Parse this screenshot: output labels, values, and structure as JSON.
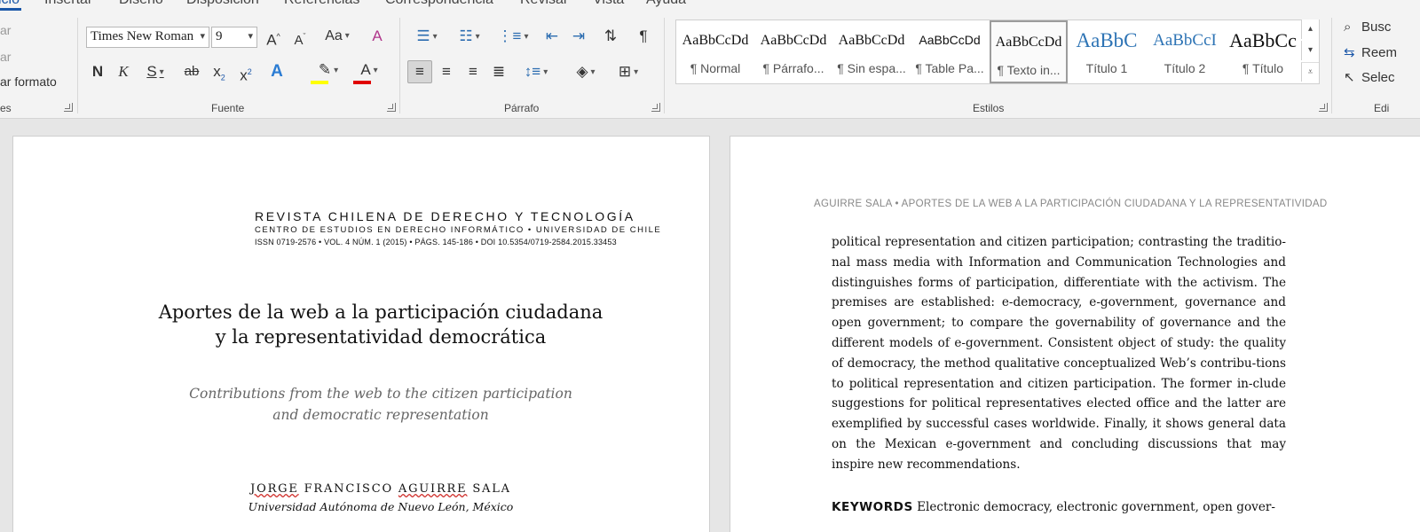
{
  "ribbon_tabs": [
    "icio",
    "Insertar",
    "Diseño",
    "Disposición",
    "Referencias",
    "Correspondencia",
    "Revisar",
    "Vista",
    "Ayuda"
  ],
  "clipboard": {
    "items": [
      "ar",
      "ar",
      "ar formato"
    ],
    "label": "es"
  },
  "font": {
    "name": "Times New Roman",
    "size": "9",
    "label": "Fuente",
    "grow": "A",
    "shrink": "A",
    "case": "Aa",
    "bold": "N",
    "italic": "K",
    "underline": "S",
    "strike": "ab",
    "subscript": "x",
    "superscript": "x",
    "effects": "A",
    "font_color": "A",
    "highlight_color": "#ffff00",
    "text_color": "#e00000"
  },
  "paragraph": {
    "label": "Párrafo"
  },
  "styles": {
    "label": "Estilos",
    "items": [
      {
        "sample": "AaBbCcDd",
        "name": "¶ Normal"
      },
      {
        "sample": "AaBbCcDd",
        "name": "¶ Párrafo..."
      },
      {
        "sample": "AaBbCcDd",
        "name": "¶ Sin espa..."
      },
      {
        "sample": "AaBbCcDd",
        "name": "¶ Table Pa..."
      },
      {
        "sample": "AaBbCcDd",
        "name": "¶ Texto in..."
      },
      {
        "sample": "AaBbC",
        "name": "Título 1"
      },
      {
        "sample": "AaBbCcI",
        "name": "Título 2"
      },
      {
        "sample": "AaBbCc",
        "name": "¶ Título"
      }
    ]
  },
  "editing": {
    "label": "Edi",
    "items": [
      "Busc",
      "Reem",
      "Selec"
    ]
  },
  "page1": {
    "journal_name": "REVISTA CHILENA DE DERECHO Y TECNOLOGÍA",
    "journal_center": "CENTRO DE ESTUDIOS EN DERECHO INFORMÁTICO • UNIVERSIDAD DE CHILE",
    "journal_issn": "ISSN 0719-2576 • VOL. 4 NÚM. 1 (2015) • PÁGS. 145-186 • DOI 10.5354/0719-2584.2015.33453",
    "title_line1": "Aportes de la web a la participación ciudadana",
    "title_line2": "y la representatividad democrática",
    "subtitle_line1": "Contributions from the web to the citizen participation",
    "subtitle_line2": "and democratic representation",
    "author_first": "JORGE",
    "author_middle": " FRANCISCO ",
    "author_last": "AGUIRRE",
    "author_end": " SALA",
    "affiliation": "Universidad Autónoma de Nuevo León, México"
  },
  "page2": {
    "running_head": "AGUIRRE SALA • APORTES DE LA WEB A LA PARTICIPACIÓN CIUDADANA Y LA REPRESENTATIVIDAD",
    "body": "political representation and citizen participation; contrasting the traditio-nal mass media with Information and Communication Technologies and distinguishes forms of participation, differentiate with the activism. The premises are established: e-democracy, e-government, governance and open government; to compare the governability of governance and the different models of e-government. Consistent object of study: the quality of democracy, the method qualitative conceptualized Web’s contribu-tions to political representation and citizen participation. The former in-clude suggestions for political representatives elected office and the latter are exemplified by successful cases worldwide. Finally, it shows general data on the Mexican e-government and concluding discussions that may inspire new recommendations.",
    "keywords_label": "KEYWORDS",
    "keywords_text": " Electronic democracy, electronic government, open gover-"
  }
}
